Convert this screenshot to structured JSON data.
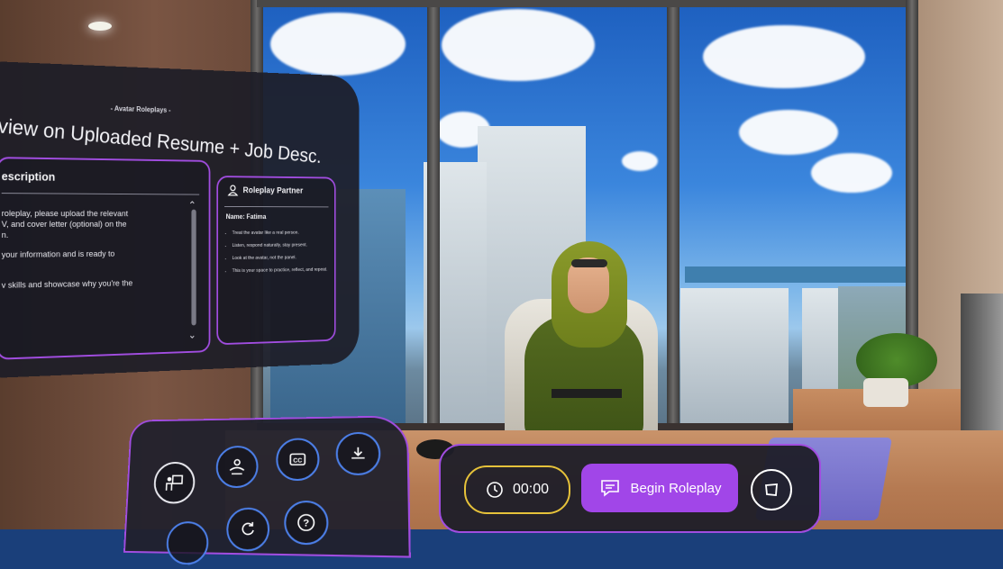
{
  "main_panel": {
    "kicker": "- Avatar Roleplays -",
    "title": "view on Uploaded Resume + Job Desc.",
    "description": {
      "heading": "escription",
      "lines": [
        "roleplay, please upload the relevant",
        "V, and cover letter (optional) on the",
        "n.",
        "your information and is ready to",
        "v skills and showcase why you're the"
      ]
    },
    "partner": {
      "heading": "Roleplay Partner",
      "name": "Name: Fatima",
      "tips": [
        "Treat the avatar like a real person.",
        "Listen, respond naturally, stay present.",
        "Look at the avatar, not the panel.",
        "This is your space to practice, reflect, and repeat."
      ]
    }
  },
  "session_bar": {
    "timer": "00:00",
    "begin_label": "Begin Roleplay"
  },
  "control_pad": {
    "icons": [
      "presenter-icon",
      "hands-icon",
      "closed-captions-icon",
      "download-icon",
      "reset-icon",
      "help-icon"
    ]
  },
  "colors": {
    "accent_purple": "#a146e8",
    "timer_yellow": "#e6c23a",
    "button_blue": "#4c7fe8",
    "panel_bg": "#1c1c26"
  }
}
